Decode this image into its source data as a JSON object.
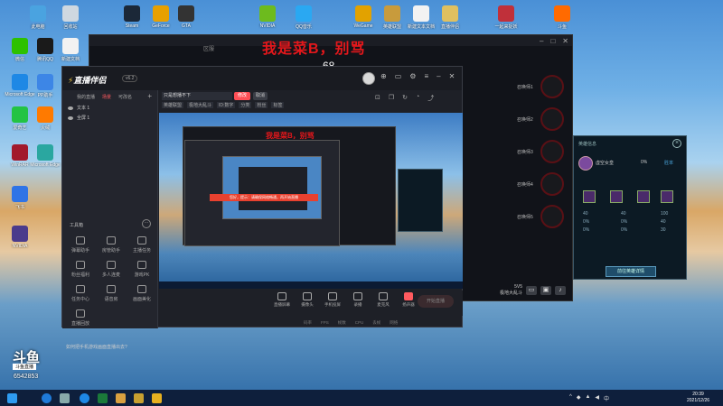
{
  "desktop": {
    "icons": [
      {
        "label": "此电脑",
        "color": "#4aa3e0"
      },
      {
        "label": "回收站",
        "color": "#cfd8e0"
      },
      {
        "label": "微信",
        "color": "#2dc100"
      },
      {
        "label": "腾讯QQ",
        "color": "#1a1a1a"
      },
      {
        "label": "新建文档",
        "color": "#f2f2f2"
      },
      {
        "label": "Microsoft Edge",
        "color": "#1e88e5"
      },
      {
        "label": "PP助手",
        "color": "#3d86e6"
      },
      {
        "label": "爱奇艺",
        "color": "#23c343"
      },
      {
        "label": "火绒",
        "color": "#ff7a00"
      },
      {
        "label": "WinRAR",
        "color": "#a21a2c"
      },
      {
        "label": "Microsoft Edge",
        "color": "#2aa7a0"
      },
      {
        "label": "飞书",
        "color": "#2f74e6"
      },
      {
        "label": "NVIDIA",
        "color": "#4a3b8c"
      },
      {
        "label": "Steam",
        "color": "#1b2838"
      },
      {
        "label": "GeForce",
        "color": "#e8a000"
      },
      {
        "label": "GTA",
        "color": "#333333"
      },
      {
        "label": "NVIDIA",
        "color": "#6dbb1e"
      },
      {
        "label": "QQ音乐",
        "color": "#2aa8f2"
      },
      {
        "label": "WeGame",
        "color": "#e2a200"
      },
      {
        "label": "英雄联盟",
        "color": "#c89b3c"
      },
      {
        "label": "新建文本文档",
        "color": "#f2f2f2"
      },
      {
        "label": "直播伴侣",
        "color": "#e0c060"
      },
      {
        "label": "一起来捉妖",
        "color": "#c0303a"
      },
      {
        "label": "斗鱼",
        "color": "#ff6a00"
      }
    ]
  },
  "game_window": {
    "tag": "区服",
    "stream_title": "我是菜B，别骂",
    "number": "68",
    "slots": [
      "召唤师1",
      "召唤师2",
      "召唤师3",
      "召唤师4",
      "召唤师5"
    ],
    "mode_top": "5V5",
    "mode_bottom": "极地大乱斗"
  },
  "side_panel": {
    "title": "英雄信息",
    "champion": "虚空女皇",
    "pct": "0%",
    "tag": "胜率",
    "button": "前往英雄详情",
    "stats_left": [
      "40",
      "0%",
      "0%"
    ],
    "stats_mid": [
      "40",
      "0%",
      "0%"
    ],
    "stats_right": [
      "100",
      "40",
      "30"
    ]
  },
  "app": {
    "logo": "直播伴侣",
    "version": "v6.2",
    "tabs": [
      "我的直播",
      "场景",
      "可改名"
    ],
    "sources": [
      "文本 1",
      "全屏 1"
    ],
    "tools_title": "工具箱",
    "tools": [
      {
        "label": "弹幕助手"
      },
      {
        "label": "房管助手"
      },
      {
        "label": "主播任务"
      },
      {
        "label": "粉丝福利"
      },
      {
        "label": "多人连麦"
      },
      {
        "label": "游戏PK"
      },
      {
        "label": "任务中心"
      },
      {
        "label": "语音房"
      },
      {
        "label": "画面美化"
      },
      {
        "label": "直播回放"
      }
    ],
    "banner": "如何把手机游戏画面直播出去?",
    "title_input": "只是想播不下",
    "btn_modify": "修改",
    "btn_cancel": "取消",
    "meta": [
      "英雄联盟",
      "极地大乱斗",
      "ID:数字",
      "分类",
      "粉丝",
      "标签"
    ],
    "toolbar": [
      {
        "label": "直播屏幕"
      },
      {
        "label": "摄像头"
      },
      {
        "label": "手机投屏"
      },
      {
        "label": "录播"
      },
      {
        "label": "麦克风"
      },
      {
        "label": "扬声器"
      }
    ],
    "btn_live": "开始直播",
    "status": [
      "码率",
      "FPS",
      "帧数",
      "CPU",
      "丢帧",
      "网络"
    ]
  },
  "preview": {
    "nested_title": "我是菜B，别骂",
    "notice": "您好，提示：请确保网络畅通，再开始直播"
  },
  "watermark": {
    "brand": "斗鱼",
    "tag": "斗鱼直播",
    "room": "6542853"
  },
  "taskbar": {
    "time": "20:39",
    "date": "2021/12/26"
  }
}
